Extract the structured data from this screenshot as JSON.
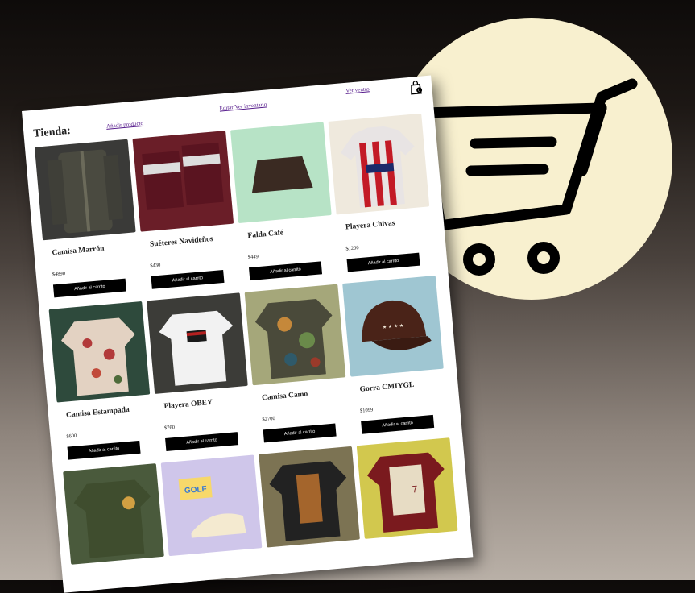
{
  "app": {
    "title": "Tienda:"
  },
  "nav": {
    "add_product": "Añadir producto",
    "edit_inventory": "Editar/Ver inventario",
    "view_sales": "Ver ventas"
  },
  "cart": {
    "count": "0"
  },
  "colors": {
    "accent": "#000000",
    "link": "#551a8b",
    "cart_circle": "#f8f0cf"
  },
  "products": [
    {
      "name": "Camisa Marrón",
      "price": "$4890",
      "button": "Añadir al carrito"
    },
    {
      "name": "Suéteres Navideños",
      "price": "$430",
      "button": "Añadir al carrito"
    },
    {
      "name": "Falda Café",
      "price": "$449",
      "button": "Añadir al carrito"
    },
    {
      "name": "Playera Chivas",
      "price": "$1200",
      "button": "Añadir al carrito"
    },
    {
      "name": "Camisa Estampada",
      "price": "$600",
      "button": "Añadir al carrito"
    },
    {
      "name": "Playera OBEY",
      "price": "$760",
      "button": "Añadir al carrito"
    },
    {
      "name": "Camisa Camo",
      "price": "$2700",
      "button": "Añadir al carrito"
    },
    {
      "name": "Gorra CMIYGL",
      "price": "$1099",
      "button": "Añadir al carrito"
    },
    {
      "name": "",
      "price": "",
      "button": ""
    },
    {
      "name": "",
      "price": "",
      "button": ""
    },
    {
      "name": "",
      "price": "",
      "button": ""
    },
    {
      "name": "",
      "price": "",
      "button": ""
    }
  ],
  "icons": {
    "cart": "shopping-cart-icon",
    "bag": "shopping-bag-icon"
  }
}
